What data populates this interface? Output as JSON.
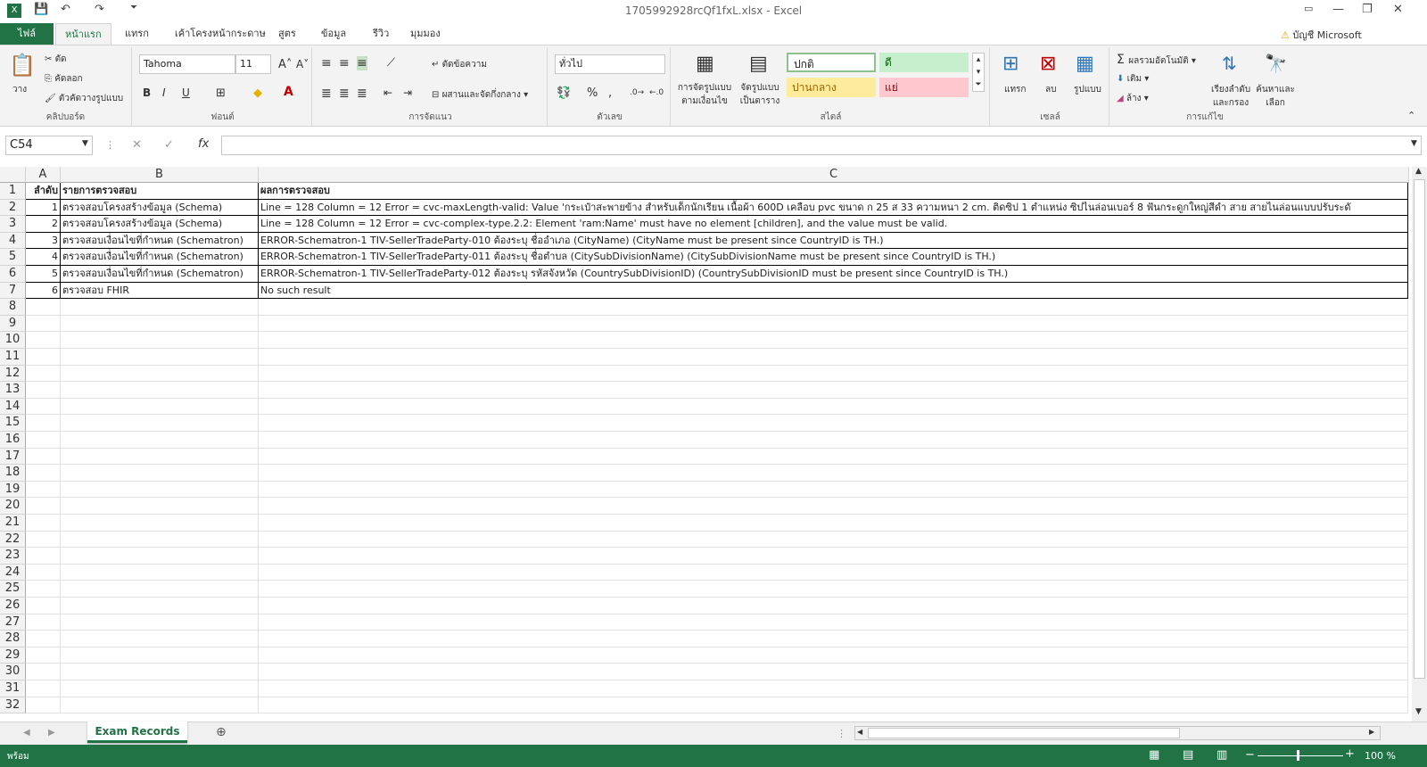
{
  "window": {
    "title": "1705992928rcQf1fxL.xlsx - Excel",
    "account": "บัญชี Microsoft"
  },
  "tabs": [
    "ไฟล์",
    "หน้าแรก",
    "แทรก",
    "เค้าโครงหน้ากระดาษ",
    "สูตร",
    "ข้อมูล",
    "รีวิว",
    "มุมมอง"
  ],
  "ribbon": {
    "clipboard": {
      "label": "คลิปบอร์ด",
      "paste": "วาง",
      "cut": "ตัด",
      "copy": "คัดลอก",
      "format_painter": "ตัวคัดวางรูปแบบ"
    },
    "font": {
      "label": "ฟอนต์",
      "name": "Tahoma",
      "size": "11",
      "bold": "B",
      "italic": "I",
      "underline": "U"
    },
    "alignment": {
      "label": "การจัดแนว",
      "wrap": "ตัดข้อความ",
      "merge": "ผสานและจัดกึ่งกลาง"
    },
    "number": {
      "label": "ตัวเลข",
      "format": "ทั่วไป",
      "percent": "%",
      "comma": ","
    },
    "styles": {
      "label": "สไตล์",
      "cond_format": "การจัดรูปแบบตามเงื่อนไข",
      "format_table": "จัดรูปแบบเป็นตาราง",
      "normal": "ปกติ",
      "good": "ดี",
      "neutral": "ปานกลาง",
      "bad": "แย่"
    },
    "cells": {
      "label": "เซลล์",
      "insert": "แทรก",
      "delete": "ลบ",
      "format": "รูปแบบ"
    },
    "editing": {
      "label": "การแก้ไข",
      "autosum": "ผลรวมอัตโนมัติ",
      "fill": "เติม",
      "clear": "ล้าง",
      "sort": "เรียงลำดับและกรอง",
      "find": "ค้นหาและเลือก"
    }
  },
  "formula_bar": {
    "name_box": "C54",
    "fx": "fx",
    "value": ""
  },
  "columns": [
    "A",
    "B",
    "C"
  ],
  "rows": [
    {
      "n": "1",
      "a": "ลำดับ",
      "b": "รายการตรวจสอบ",
      "c": "ผลการตรวจสอบ"
    },
    {
      "n": "2",
      "a": "1",
      "b": "ตรวจสอบโครงสร้างข้อมูล (Schema)",
      "c": "Line = 128 Column = 12 Error = cvc-maxLength-valid: Value 'กระเป๋าสะพายข้าง สำหรับเด็กนักเรียน เนื้อผ้า 600D เคลือบ pvc ขนาด ก 25 ส 33 ความหนา 2 cm. ติดซิป 1 ตำแหน่ง ซิปไนล่อนเบอร์ 8 ฟันกระดูกใหญ่สีดำ สาย สายไนล่อนแบบปรับระดั"
    },
    {
      "n": "3",
      "a": "2",
      "b": "ตรวจสอบโครงสร้างข้อมูล (Schema)",
      "c": "Line = 128 Column = 12 Error = cvc-complex-type.2.2: Element 'ram:Name' must have no element [children], and the value must be valid."
    },
    {
      "n": "4",
      "a": "3",
      "b": "ตรวจสอบเงื่อนไขที่กำหนด (Schematron)",
      "c": "ERROR-Schematron-1 TIV-SellerTradeParty-010                ต้องระบุ ชื่ออำเภอ (CityName) (CityName must be present since CountryID is TH.)"
    },
    {
      "n": "5",
      "a": "4",
      "b": "ตรวจสอบเงื่อนไขที่กำหนด (Schematron)",
      "c": "ERROR-Schematron-1 TIV-SellerTradeParty-011 ต้องระบุ ชื่อตำบล (CitySubDivisionName)             (CitySubDivisionName must be present since CountryID is TH.)"
    },
    {
      "n": "6",
      "a": "5",
      "b": "ตรวจสอบเงื่อนไขที่กำหนด (Schematron)",
      "c": "ERROR-Schematron-1 TIV-SellerTradeParty-012 ต้องระบุ รหัสจังหวัด (CountrySubDivisionID)             (CountrySubDivisionID must be present since CountryID is TH.)"
    },
    {
      "n": "7",
      "a": "6",
      "b": "ตรวจสอบ FHIR",
      "c": "No such result"
    }
  ],
  "empty_rows": [
    "8",
    "9",
    "10",
    "11",
    "12",
    "13",
    "14",
    "15",
    "16",
    "17",
    "18",
    "19",
    "20",
    "21",
    "22",
    "23",
    "24",
    "25",
    "26",
    "27",
    "28",
    "29",
    "30",
    "31",
    "32"
  ],
  "sheet_tab": "Exam Records",
  "status": {
    "ready": "พร้อม",
    "zoom": "100 %"
  },
  "colors": {
    "accent": "#217346"
  }
}
